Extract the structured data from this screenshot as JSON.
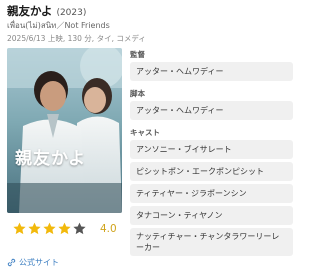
{
  "movie": {
    "title": "親友かよ",
    "year": "(2023)",
    "original_title": "เพื่อน(ไม่)สนิท／Not Friends",
    "meta": "2025/6/13 上映, 130 分, タイ, コメディ"
  },
  "poster": {
    "title_text": "親友かよ"
  },
  "rating": {
    "value": "4.0",
    "stars_filled": 4,
    "stars_total": 5,
    "star_color": "#f2b90c",
    "star_empty_color": "#555555"
  },
  "link": {
    "label": "公式サイト",
    "color": "#3d7fc2"
  },
  "credits": {
    "director_label": "監督",
    "director": [
      "アッター・ヘムワディー"
    ],
    "writer_label": "脚本",
    "writer": [
      "アッター・ヘムワディー"
    ],
    "cast_label": "キャスト",
    "cast": [
      "アンソニー・ブイサレート",
      "ピシットポン・エークポンピシット",
      "ティティヤー・ジラポーンシン",
      "タナコーン・ティヤノン",
      "ナッティチャー・チャンタラワーリーレーカー"
    ]
  }
}
